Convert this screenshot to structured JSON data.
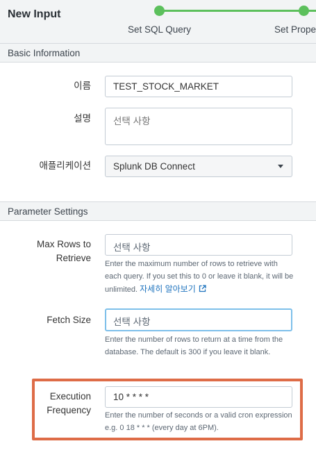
{
  "header": {
    "title": "New Input",
    "steps": [
      {
        "label": "Set SQL Query",
        "state": "complete"
      },
      {
        "label": "Set Prope",
        "state": "complete"
      }
    ]
  },
  "basic_info": {
    "section_title": "Basic Information",
    "name": {
      "label": "이름",
      "value": "TEST_STOCK_MARKET"
    },
    "description": {
      "label": "설명",
      "placeholder": "선택 사항"
    },
    "application": {
      "label": "애플리케이션",
      "value": "Splunk DB Connect",
      "icon": "caret-down-icon"
    }
  },
  "parameter_settings": {
    "section_title": "Parameter Settings",
    "max_rows": {
      "label_line1": "Max Rows to",
      "label_line2": "Retrieve",
      "placeholder": "선택 사항",
      "help": "Enter the maximum number of rows to retrieve with each query. If you set this to 0 or leave it blank, it will be unlimited. ",
      "link_text": "자세히 알아보기",
      "link_icon": "external-link-icon"
    },
    "fetch_size": {
      "label": "Fetch Size",
      "placeholder": "선택 사항",
      "help": "Enter the number of rows to return at a time from the database. The default is 300 if you leave it blank."
    },
    "execution_frequency": {
      "label_line1": "Execution",
      "label_line2": "Frequency",
      "value": "10 * * * *",
      "help": "Enter the number of seconds or a valid cron expression e.g. 0 18 * * * (every day at 6PM)."
    }
  },
  "colors": {
    "step_green": "#5cc05c",
    "highlight_border": "#de6c47",
    "link_blue": "#1e73be",
    "focus_border": "#7dbfea"
  }
}
